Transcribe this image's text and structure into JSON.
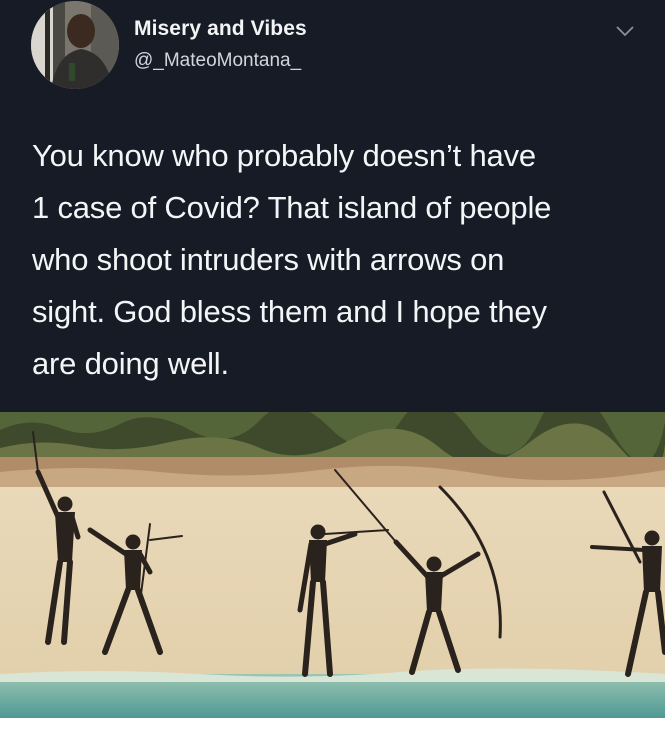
{
  "tweet": {
    "display_name": "Misery and Vibes",
    "handle": "@_MateoMontana_",
    "text_lines": [
      "You know who probably doesn’t have",
      "1 case of Covid? That island of people",
      "who shoot intruders with arrows on",
      "sight. God bless them and I hope they",
      "are doing well."
    ],
    "menu_icon": "chevron-down-icon"
  },
  "photo": {
    "subject": "beach-archers-photo"
  },
  "colors": {
    "background": "#161b26",
    "text": "#f4f5f7",
    "handle": "#d2d6dc",
    "sand": "#e6d5b4",
    "water": "#6fb3a8"
  }
}
